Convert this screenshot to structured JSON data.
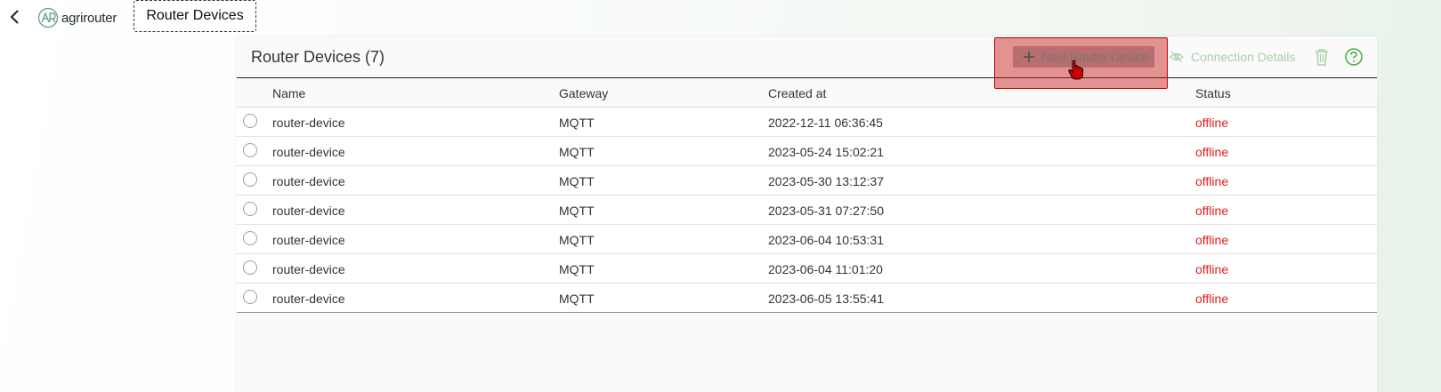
{
  "topbar": {
    "logo_text": "agrirouter",
    "page_chip": "Router Devices"
  },
  "card": {
    "title": "Router Devices (7)",
    "toolbar": {
      "new_label": "New Router Device",
      "connection_label": "Connection Details"
    },
    "columns": [
      "Name",
      "Gateway",
      "Created at",
      "Status"
    ],
    "rows": [
      {
        "name": "router-device",
        "gateway": "MQTT",
        "created": "2022-12-11 06:36:45",
        "status": "offline"
      },
      {
        "name": "router-device",
        "gateway": "MQTT",
        "created": "2023-05-24 15:02:21",
        "status": "offline"
      },
      {
        "name": "router-device",
        "gateway": "MQTT",
        "created": "2023-05-30 13:12:37",
        "status": "offline"
      },
      {
        "name": "router-device",
        "gateway": "MQTT",
        "created": "2023-05-31 07:27:50",
        "status": "offline"
      },
      {
        "name": "router-device",
        "gateway": "MQTT",
        "created": "2023-06-04 10:53:31",
        "status": "offline"
      },
      {
        "name": "router-device",
        "gateway": "MQTT",
        "created": "2023-06-04 11:01:20",
        "status": "offline"
      },
      {
        "name": "router-device",
        "gateway": "MQTT",
        "created": "2023-06-05 13:55:41",
        "status": "offline"
      }
    ]
  },
  "colors": {
    "status_offline": "#e31b1b",
    "accent_green": "#4caf50",
    "highlight_red": "#c00000"
  }
}
